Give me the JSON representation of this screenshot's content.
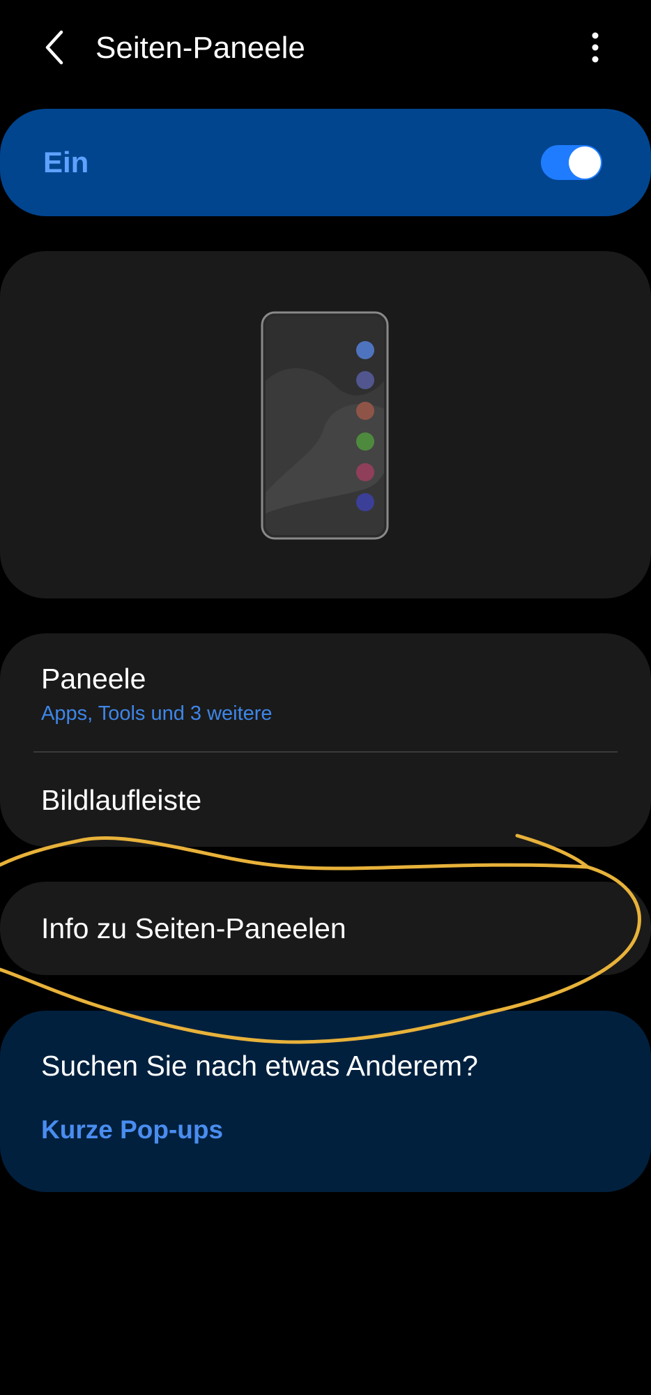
{
  "header": {
    "title": "Seiten-Paneele",
    "back_icon": "back-arrow-icon",
    "more_icon": "more-vertical-icon"
  },
  "master_switch": {
    "label": "Ein",
    "state": "on",
    "accent_color": "#1f7cff",
    "card_color": "#01458f"
  },
  "illustration": {
    "icon": "phone-edge-panel-illustration",
    "dot_colors": [
      "#4f74bf",
      "#51568f",
      "#8f5448",
      "#4e8a3e",
      "#8f3f5a",
      "#3c3f97"
    ]
  },
  "settings": {
    "panels": {
      "title": "Paneele",
      "subtitle": "Apps, Tools und 3 weitere"
    },
    "scroll_bar": {
      "title": "Bildlaufleiste"
    },
    "info": {
      "title": "Info zu Seiten-Paneelen"
    }
  },
  "suggestion": {
    "heading": "Suchen Sie nach etwas Anderem?",
    "link": "Kurze Pop-ups"
  },
  "annotation": {
    "color": "#e8b23a",
    "icon": "hand-drawn-circle-highlight"
  }
}
